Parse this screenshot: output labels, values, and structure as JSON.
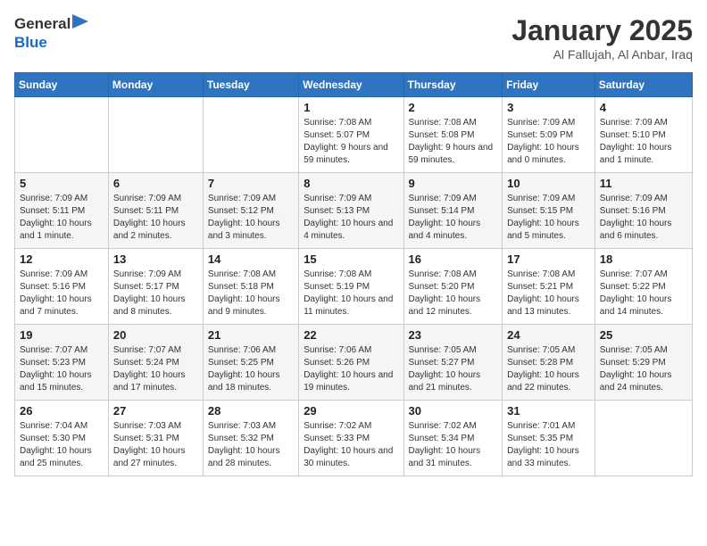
{
  "header": {
    "logo_line1": "General",
    "logo_line2": "Blue",
    "title": "January 2025",
    "subtitle": "Al Fallujah, Al Anbar, Iraq"
  },
  "days_of_week": [
    "Sunday",
    "Monday",
    "Tuesday",
    "Wednesday",
    "Thursday",
    "Friday",
    "Saturday"
  ],
  "weeks": [
    [
      {
        "day": "",
        "info": ""
      },
      {
        "day": "",
        "info": ""
      },
      {
        "day": "",
        "info": ""
      },
      {
        "day": "1",
        "info": "Sunrise: 7:08 AM\nSunset: 5:07 PM\nDaylight: 9 hours and 59 minutes."
      },
      {
        "day": "2",
        "info": "Sunrise: 7:08 AM\nSunset: 5:08 PM\nDaylight: 9 hours and 59 minutes."
      },
      {
        "day": "3",
        "info": "Sunrise: 7:09 AM\nSunset: 5:09 PM\nDaylight: 10 hours and 0 minutes."
      },
      {
        "day": "4",
        "info": "Sunrise: 7:09 AM\nSunset: 5:10 PM\nDaylight: 10 hours and 1 minute."
      }
    ],
    [
      {
        "day": "5",
        "info": "Sunrise: 7:09 AM\nSunset: 5:11 PM\nDaylight: 10 hours and 1 minute."
      },
      {
        "day": "6",
        "info": "Sunrise: 7:09 AM\nSunset: 5:11 PM\nDaylight: 10 hours and 2 minutes."
      },
      {
        "day": "7",
        "info": "Sunrise: 7:09 AM\nSunset: 5:12 PM\nDaylight: 10 hours and 3 minutes."
      },
      {
        "day": "8",
        "info": "Sunrise: 7:09 AM\nSunset: 5:13 PM\nDaylight: 10 hours and 4 minutes."
      },
      {
        "day": "9",
        "info": "Sunrise: 7:09 AM\nSunset: 5:14 PM\nDaylight: 10 hours and 4 minutes."
      },
      {
        "day": "10",
        "info": "Sunrise: 7:09 AM\nSunset: 5:15 PM\nDaylight: 10 hours and 5 minutes."
      },
      {
        "day": "11",
        "info": "Sunrise: 7:09 AM\nSunset: 5:16 PM\nDaylight: 10 hours and 6 minutes."
      }
    ],
    [
      {
        "day": "12",
        "info": "Sunrise: 7:09 AM\nSunset: 5:16 PM\nDaylight: 10 hours and 7 minutes."
      },
      {
        "day": "13",
        "info": "Sunrise: 7:09 AM\nSunset: 5:17 PM\nDaylight: 10 hours and 8 minutes."
      },
      {
        "day": "14",
        "info": "Sunrise: 7:08 AM\nSunset: 5:18 PM\nDaylight: 10 hours and 9 minutes."
      },
      {
        "day": "15",
        "info": "Sunrise: 7:08 AM\nSunset: 5:19 PM\nDaylight: 10 hours and 11 minutes."
      },
      {
        "day": "16",
        "info": "Sunrise: 7:08 AM\nSunset: 5:20 PM\nDaylight: 10 hours and 12 minutes."
      },
      {
        "day": "17",
        "info": "Sunrise: 7:08 AM\nSunset: 5:21 PM\nDaylight: 10 hours and 13 minutes."
      },
      {
        "day": "18",
        "info": "Sunrise: 7:07 AM\nSunset: 5:22 PM\nDaylight: 10 hours and 14 minutes."
      }
    ],
    [
      {
        "day": "19",
        "info": "Sunrise: 7:07 AM\nSunset: 5:23 PM\nDaylight: 10 hours and 15 minutes."
      },
      {
        "day": "20",
        "info": "Sunrise: 7:07 AM\nSunset: 5:24 PM\nDaylight: 10 hours and 17 minutes."
      },
      {
        "day": "21",
        "info": "Sunrise: 7:06 AM\nSunset: 5:25 PM\nDaylight: 10 hours and 18 minutes."
      },
      {
        "day": "22",
        "info": "Sunrise: 7:06 AM\nSunset: 5:26 PM\nDaylight: 10 hours and 19 minutes."
      },
      {
        "day": "23",
        "info": "Sunrise: 7:05 AM\nSunset: 5:27 PM\nDaylight: 10 hours and 21 minutes."
      },
      {
        "day": "24",
        "info": "Sunrise: 7:05 AM\nSunset: 5:28 PM\nDaylight: 10 hours and 22 minutes."
      },
      {
        "day": "25",
        "info": "Sunrise: 7:05 AM\nSunset: 5:29 PM\nDaylight: 10 hours and 24 minutes."
      }
    ],
    [
      {
        "day": "26",
        "info": "Sunrise: 7:04 AM\nSunset: 5:30 PM\nDaylight: 10 hours and 25 minutes."
      },
      {
        "day": "27",
        "info": "Sunrise: 7:03 AM\nSunset: 5:31 PM\nDaylight: 10 hours and 27 minutes."
      },
      {
        "day": "28",
        "info": "Sunrise: 7:03 AM\nSunset: 5:32 PM\nDaylight: 10 hours and 28 minutes."
      },
      {
        "day": "29",
        "info": "Sunrise: 7:02 AM\nSunset: 5:33 PM\nDaylight: 10 hours and 30 minutes."
      },
      {
        "day": "30",
        "info": "Sunrise: 7:02 AM\nSunset: 5:34 PM\nDaylight: 10 hours and 31 minutes."
      },
      {
        "day": "31",
        "info": "Sunrise: 7:01 AM\nSunset: 5:35 PM\nDaylight: 10 hours and 33 minutes."
      },
      {
        "day": "",
        "info": ""
      }
    ]
  ]
}
